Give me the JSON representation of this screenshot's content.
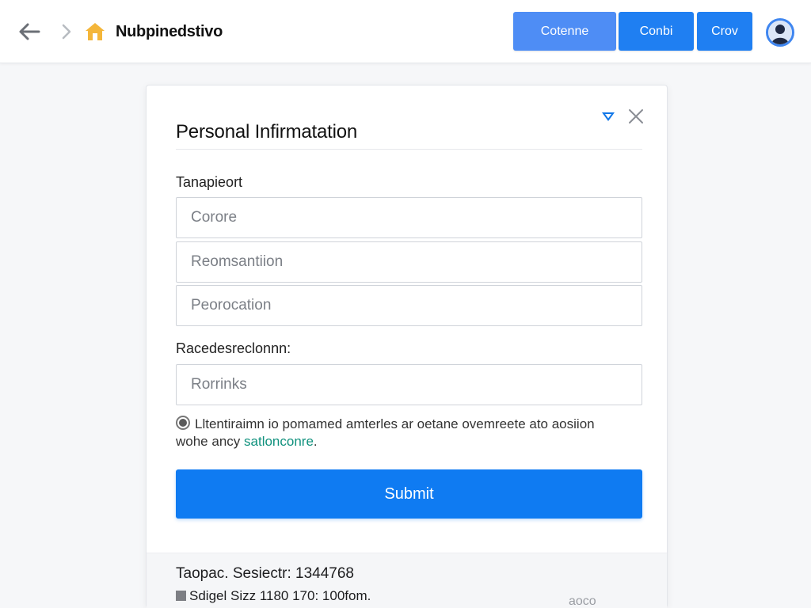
{
  "header": {
    "app_title": "Nubpinedstivo",
    "buttons": [
      "Cotenne",
      "Conbi",
      "Crov"
    ]
  },
  "icons": {
    "back": "arrow-left-icon",
    "forward": "chevron-right-icon",
    "home": "home-icon",
    "pin": "pin-icon",
    "close": "close-icon",
    "avatar": "user-avatar-icon"
  },
  "colors": {
    "primary": "#0f7bf2",
    "home_icon": "#f4b63a",
    "link": "#10917d"
  },
  "form": {
    "title": "Personal Infirmatation",
    "section_1_label": "Tanapieort",
    "inputs": [
      {
        "placeholder": "Corore",
        "value": ""
      },
      {
        "placeholder": "Reomsantiion",
        "value": ""
      },
      {
        "placeholder": "Peorocation",
        "value": ""
      }
    ],
    "section_2_label": "Racedesreclonnn:",
    "input_4": {
      "placeholder": "Rorrinks",
      "value": ""
    },
    "notice_text": "Lltentiraimn io pomamed amterles ar oetane ovemreete ato aosiion wohe ancy",
    "notice_link": "satlonconre",
    "notice_end": ".",
    "submit_label": "Submit"
  },
  "footer": {
    "line_1": "Taopac. Sesiectr: 1344768",
    "line_2": "Sdigel Sizz 1180 170: 100fom.",
    "code": "aoco"
  }
}
